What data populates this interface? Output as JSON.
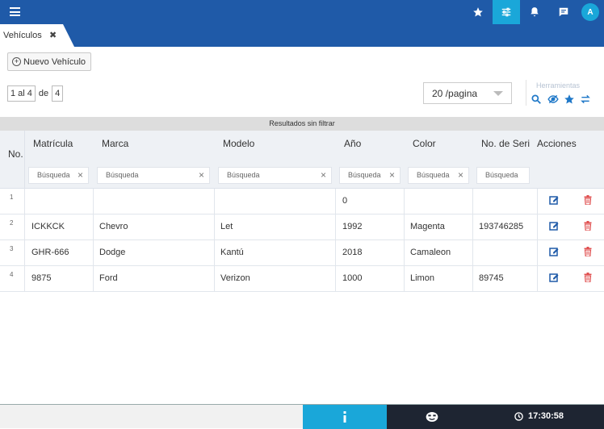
{
  "topbar": {
    "icons": [
      "menu-icon",
      "star-icon",
      "sliders-icon",
      "bell-icon",
      "chat-icon"
    ],
    "avatar_initial": "A",
    "color": "#1f5aa8",
    "accent": "#1aa7d9"
  },
  "tab": {
    "label": "Vehículos",
    "close": "✖"
  },
  "toolbar": {
    "new_vehicle_label": "Nuevo Vehículo"
  },
  "pager": {
    "range": "1 al 4",
    "of_label": "de",
    "total": "4"
  },
  "page_size": {
    "selected": "20 /pagina"
  },
  "tools": {
    "title": "Herramientas",
    "icons": [
      "search-icon",
      "hide-icon",
      "star-icon",
      "swap-icon"
    ]
  },
  "filter_banner": "Resultados sin filtrar",
  "table": {
    "columns": [
      "No.",
      "Matrícula",
      "Marca",
      "Modelo",
      "Año",
      "Color",
      "No. de Seri",
      "Acciones"
    ],
    "search_placeholder": "Búsqueda",
    "rows": [
      {
        "no": "1",
        "matricula": "",
        "marca": "",
        "modelo": "",
        "anio": "0",
        "color": "",
        "serie": ""
      },
      {
        "no": "2",
        "matricula": "ICKKCK",
        "marca": "Chevro",
        "modelo": "Let",
        "anio": "1992",
        "color": "Magenta",
        "serie": "193746285"
      },
      {
        "no": "3",
        "matricula": "GHR-666",
        "marca": "Dodge",
        "modelo": "Kantú",
        "anio": "2018",
        "color": "Camaleon",
        "serie": ""
      },
      {
        "no": "4",
        "matricula": "9875",
        "marca": "Ford",
        "modelo": "Verizon",
        "anio": "1000",
        "color": "Limon",
        "serie": "89745"
      }
    ]
  },
  "footer": {
    "time": "17:30:58"
  }
}
